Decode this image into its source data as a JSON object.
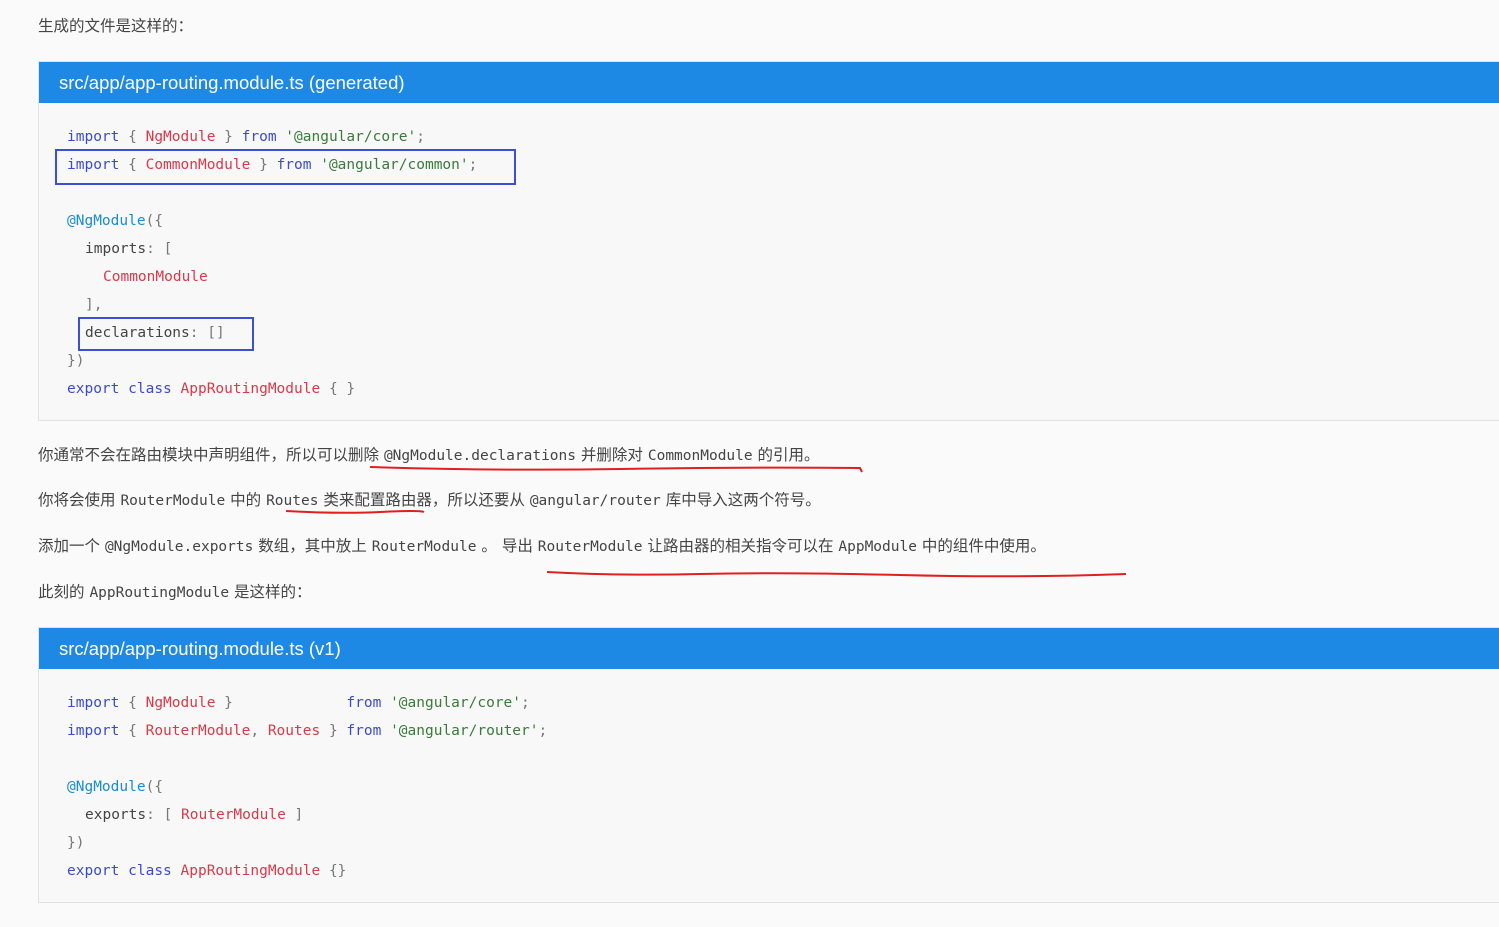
{
  "intro": "生成的文件是这样的：",
  "card1": {
    "title": "src/app/app-routing.module.ts (generated)",
    "l1": {
      "kw": "import",
      "ob": "{",
      "id": "NgModule",
      "cb": "}",
      "from": "from",
      "str": "'@angular/core'",
      "semi": ";"
    },
    "l2": {
      "kw": "import",
      "ob": "{",
      "id": "CommonModule",
      "cb": "}",
      "from": "from",
      "str": "'@angular/common'",
      "semi": ";"
    },
    "l4": {
      "dec": "@NgModule",
      "open": "({"
    },
    "l5": {
      "key": "imports",
      "rest": ": ["
    },
    "l6": {
      "id": "CommonModule"
    },
    "l7": {
      "text": "],"
    },
    "l8": {
      "key": "declarations",
      "rest": ": []"
    },
    "l9": {
      "text": "})"
    },
    "l10": {
      "kw1": "export",
      "kw2": "class",
      "id": "AppRoutingModule",
      "rest": "{ }"
    }
  },
  "p1": {
    "a": "你通常不会在路由模块中声明组件，所以可以删除 ",
    "c1": "@NgModule.declarations",
    "b": " 并删除对 ",
    "c2": "CommonModule",
    "d": " 的引用。"
  },
  "p2": {
    "a": "你将会使用 ",
    "c1": "RouterModule",
    "b": " 中的 ",
    "c2": "Routes",
    "c": " 类来配置路由器，所以还要从 ",
    "c3": "@angular/router",
    "d": " 库中导入这两个符号。"
  },
  "p3": {
    "a": "添加一个 ",
    "c1": "@NgModule.exports",
    "b": " 数组，其中放上 ",
    "c2": "RouterModule",
    "c": " 。 导出 ",
    "c3": "RouterModule",
    "d": " 让路由器的相关指令可以在 ",
    "c4": "AppModule",
    "e": " 中的组件中使用。"
  },
  "p4": {
    "a": "此刻的 ",
    "c1": "AppRoutingModule",
    "b": " 是这样的："
  },
  "card2": {
    "title": "src/app/app-routing.module.ts (v1)",
    "l1": {
      "kw": "import",
      "ob": "{",
      "id": "NgModule",
      "cb": "}",
      "from": "from",
      "str": "'@angular/core'",
      "semi": ";"
    },
    "l2": {
      "kw": "import",
      "ob": "{",
      "id1": "RouterModule",
      "comma": ",",
      "id2": "Routes",
      "cb": "}",
      "from": "from",
      "str": "'@angular/router'",
      "semi": ";"
    },
    "l4": {
      "dec": "@NgModule",
      "open": "({"
    },
    "l5": {
      "key": "exports",
      "rest": ": [",
      "id": "RouterModule",
      "close": "]"
    },
    "l6": {
      "text": "})"
    },
    "l7": {
      "kw1": "export",
      "kw2": "class",
      "id": "AppRoutingModule",
      "rest": "{}"
    }
  },
  "colors": {
    "header": "#1e88e5",
    "keyword": "#3b4bd0",
    "identifier": "#d73a49",
    "string": "#3a7a3a",
    "decorator": "#1a8ccf",
    "highlight_box": "#3c4fd6",
    "underline": "#e02020"
  }
}
